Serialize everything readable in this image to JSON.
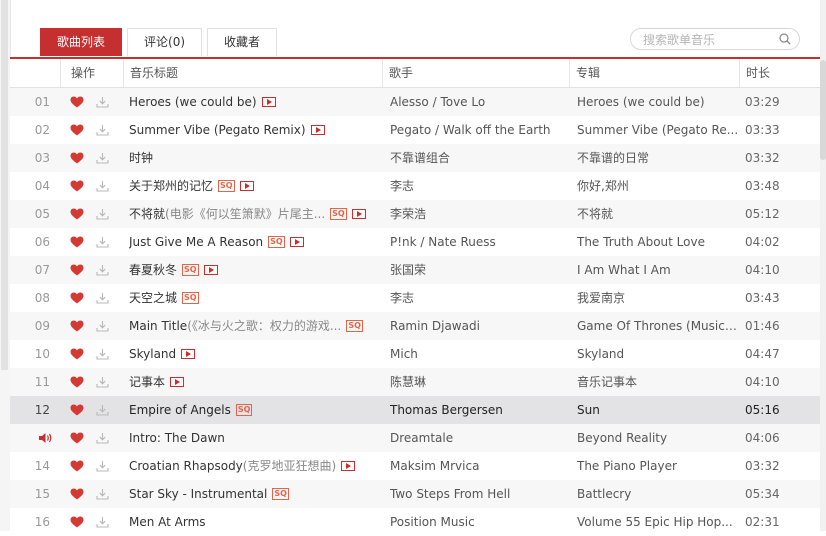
{
  "tabs": [
    {
      "label": "歌曲列表",
      "active": true
    },
    {
      "label": "评论(0)",
      "active": false
    },
    {
      "label": "收藏者",
      "active": false
    }
  ],
  "search": {
    "placeholder": "搜索歌单音乐"
  },
  "columns": {
    "ops": "操作",
    "title": "音乐标题",
    "artist": "歌手",
    "album": "专辑",
    "duration": "时长"
  },
  "colors": {
    "accent": "#c62f2f",
    "heart": "#d33a31",
    "sq": "#e0654b"
  },
  "tracks": [
    {
      "index": "01",
      "title": "Heroes (we could be)",
      "alias": "",
      "sq": false,
      "mv": true,
      "artist": "Alesso / Tove Lo",
      "album": "Heroes (we could be)",
      "duration": "03:29"
    },
    {
      "index": "02",
      "title": "Summer Vibe (Pegato Remix)",
      "alias": "",
      "sq": false,
      "mv": true,
      "artist": "Pegato / Walk off the Earth",
      "album": "Summer Vibe (Pegato Re...",
      "duration": "03:33"
    },
    {
      "index": "03",
      "title": "时钟",
      "alias": "",
      "sq": false,
      "mv": false,
      "artist": "不靠谱组合",
      "album": "不靠谱的日常",
      "duration": "03:32"
    },
    {
      "index": "04",
      "title": "关于郑州的记忆",
      "alias": "",
      "sq": true,
      "mv": true,
      "artist": "李志",
      "album": "你好,郑州",
      "duration": "03:48"
    },
    {
      "index": "05",
      "title": "不将就",
      "alias": "(电影《何以笙箫默》片尾主...",
      "sq": true,
      "mv": true,
      "artist": "李荣浩",
      "album": "不将就",
      "duration": "05:12"
    },
    {
      "index": "06",
      "title": "Just Give Me A Reason",
      "alias": "",
      "sq": true,
      "mv": true,
      "artist": "P!nk / Nate Ruess",
      "album": "The Truth About Love",
      "duration": "04:02"
    },
    {
      "index": "07",
      "title": "春夏秋冬",
      "alias": "",
      "sq": true,
      "mv": true,
      "artist": "张国荣",
      "album": "I Am What I Am",
      "duration": "04:10"
    },
    {
      "index": "08",
      "title": "天空之城",
      "alias": "",
      "sq": true,
      "mv": false,
      "artist": "李志",
      "album": "我爱南京",
      "duration": "03:43"
    },
    {
      "index": "09",
      "title": "Main Title",
      "alias": "(《冰与火之歌：权力的游戏...",
      "sq": true,
      "mv": false,
      "artist": "Ramin Djawadi",
      "album": "Game Of Thrones (Music f...",
      "duration": "01:46"
    },
    {
      "index": "10",
      "title": "Skyland",
      "alias": "",
      "sq": false,
      "mv": true,
      "artist": "Mich",
      "album": "Skyland",
      "duration": "04:47"
    },
    {
      "index": "11",
      "title": "记事本",
      "alias": "",
      "sq": false,
      "mv": true,
      "artist": "陈慧琳",
      "album": "音乐记事本",
      "duration": "04:10"
    },
    {
      "index": "12",
      "title": "Empire of Angels",
      "alias": "",
      "sq": true,
      "mv": false,
      "artist": "Thomas Bergersen",
      "album": "Sun",
      "duration": "05:16",
      "selected": true
    },
    {
      "index": "",
      "title": "Intro: The Dawn",
      "alias": "",
      "sq": false,
      "mv": false,
      "artist": "Dreamtale",
      "album": "Beyond Reality",
      "duration": "04:06",
      "playing": true
    },
    {
      "index": "14",
      "title": "Croatian Rhapsody",
      "alias": "(克罗地亚狂想曲)",
      "sq": false,
      "mv": true,
      "artist": "Maksim Mrvica",
      "album": "The Piano Player",
      "duration": "03:32"
    },
    {
      "index": "15",
      "title": "Star Sky - Instrumental",
      "alias": "",
      "sq": true,
      "mv": false,
      "artist": "Two Steps From Hell",
      "album": "Battlecry",
      "duration": "05:34"
    },
    {
      "index": "16",
      "title": "Men At Arms",
      "alias": "",
      "sq": false,
      "mv": false,
      "artist": "Position Music",
      "album": "Volume 55 Epic Hip Hop...",
      "duration": "02:31"
    }
  ]
}
